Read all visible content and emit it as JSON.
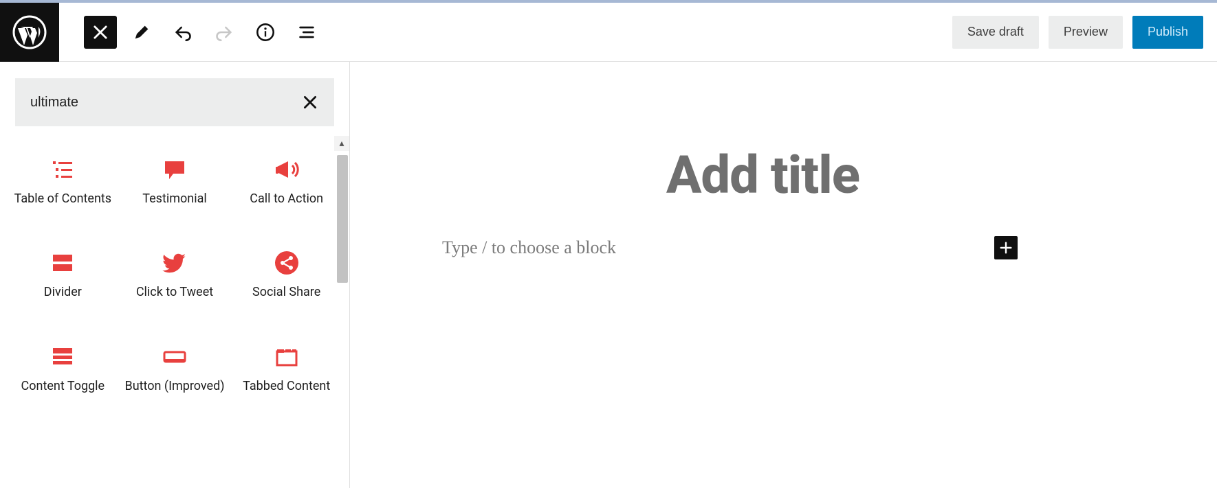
{
  "toolbar": {
    "save_draft": "Save draft",
    "preview": "Preview",
    "publish": "Publish"
  },
  "search": {
    "value": "ultimate"
  },
  "blocks": [
    {
      "label": "Table of Contents",
      "icon": "toc"
    },
    {
      "label": "Testimonial",
      "icon": "speech"
    },
    {
      "label": "Call to Action",
      "icon": "megaphone"
    },
    {
      "label": "Divider",
      "icon": "divider"
    },
    {
      "label": "Click to Tweet",
      "icon": "twitter"
    },
    {
      "label": "Social Share",
      "icon": "share"
    },
    {
      "label": "Content Toggle",
      "icon": "toggle"
    },
    {
      "label": "Button (Improved)",
      "icon": "button"
    },
    {
      "label": "Tabbed Content",
      "icon": "tabbed"
    }
  ],
  "editor": {
    "title_placeholder": "Add title",
    "body_placeholder": "Type / to choose a block"
  },
  "colors": {
    "accent": "#e8403e"
  }
}
